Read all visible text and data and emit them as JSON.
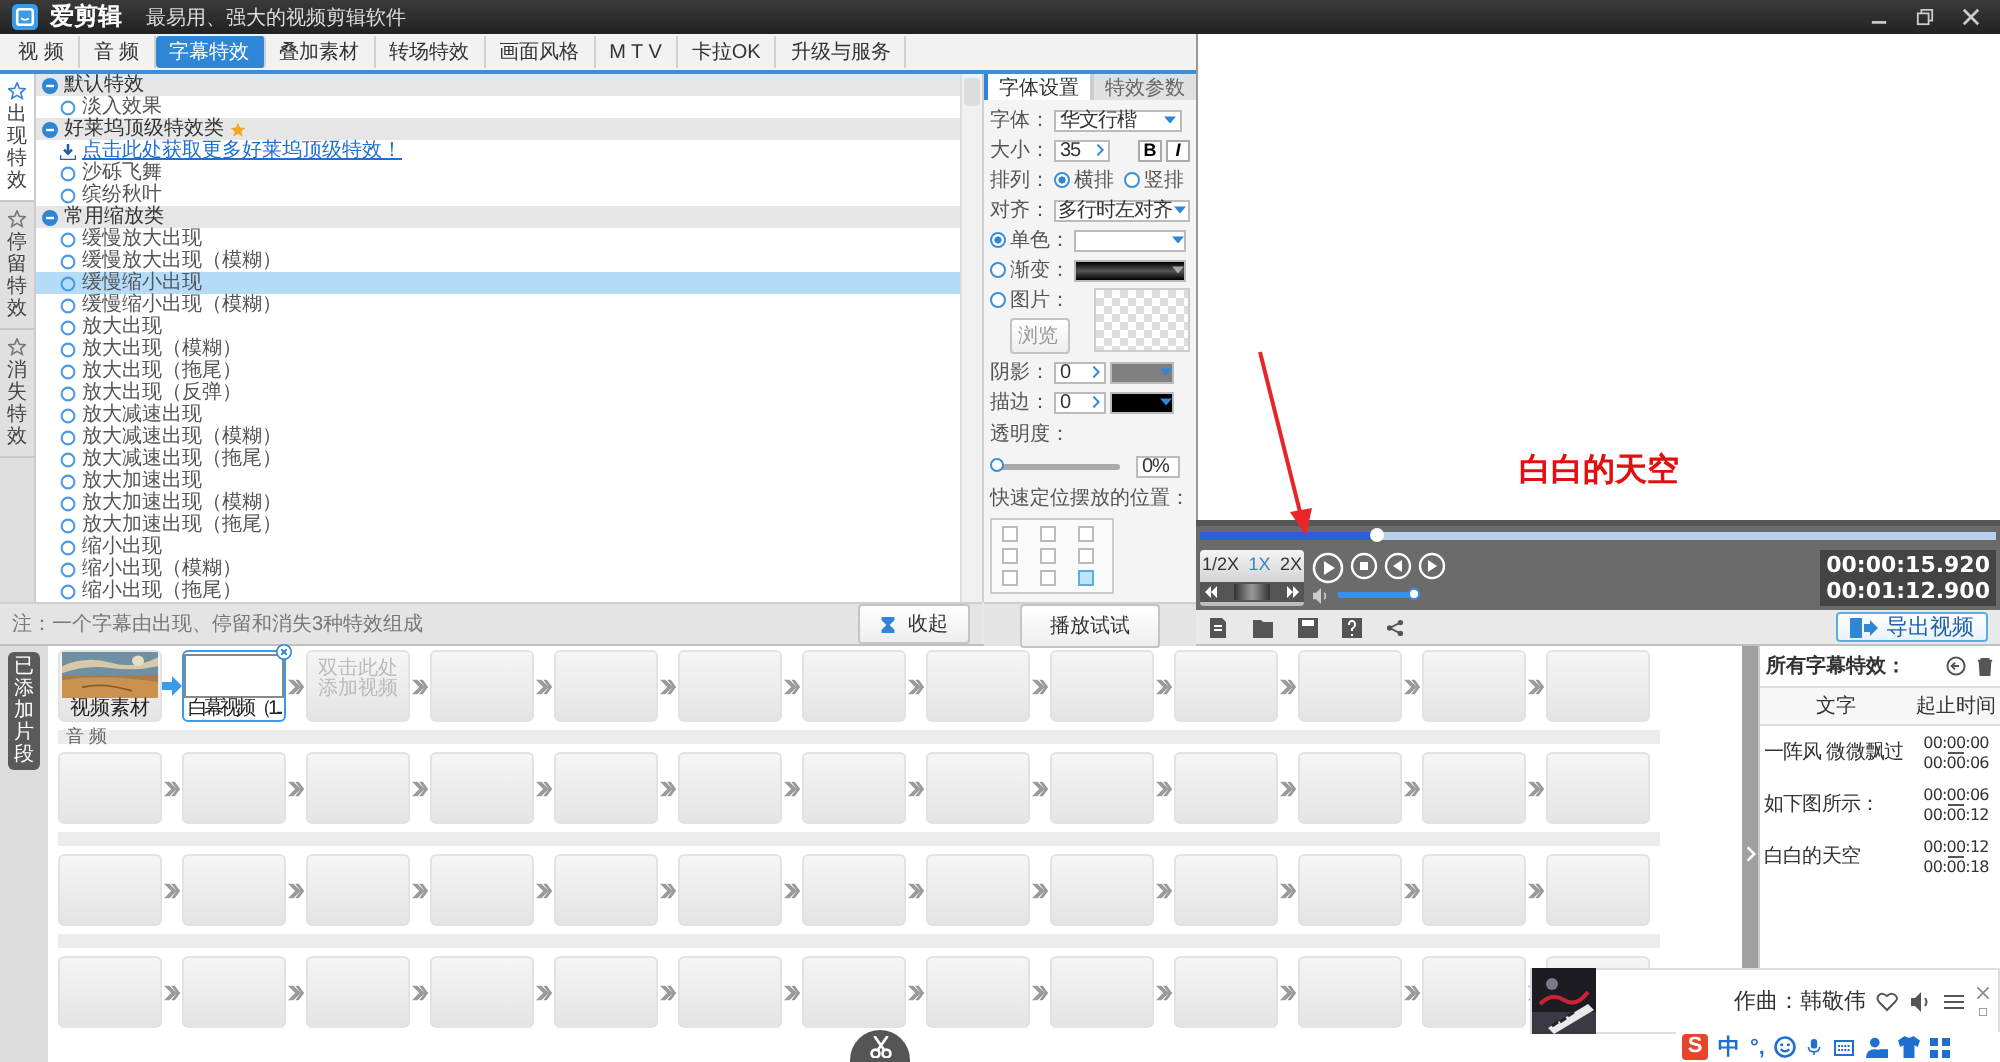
{
  "app": {
    "name": "爱剪辑",
    "tagline": "最易用、强大的视频剪辑软件"
  },
  "tabs": [
    {
      "label": "视 频",
      "selected": false
    },
    {
      "label": "音 频",
      "selected": false
    },
    {
      "label": "字幕特效",
      "selected": true
    },
    {
      "label": "叠加素材",
      "selected": false
    },
    {
      "label": "转场特效",
      "selected": false
    },
    {
      "label": "画面风格",
      "selected": false
    },
    {
      "label": "M T V",
      "selected": false
    },
    {
      "label": "卡拉OK",
      "selected": false
    },
    {
      "label": "升级与服务",
      "selected": false
    }
  ],
  "side_tabs": [
    {
      "label": "出现特效",
      "selected": true
    },
    {
      "label": "停留特效",
      "selected": false
    },
    {
      "label": "消失特效",
      "selected": false
    }
  ],
  "effect_groups": [
    {
      "title": "默认特效",
      "starred": false,
      "items": [
        {
          "kind": "option",
          "label": "淡入效果",
          "selected": false
        }
      ]
    },
    {
      "title": "好莱坞顶级特效类",
      "starred": true,
      "items": [
        {
          "kind": "link",
          "label": "点击此处获取更多好莱坞顶级特效！"
        },
        {
          "kind": "option",
          "label": "沙砾飞舞",
          "selected": false
        },
        {
          "kind": "option",
          "label": "缤纷秋叶",
          "selected": false
        }
      ]
    },
    {
      "title": "常用缩放类",
      "starred": false,
      "items": [
        {
          "kind": "option",
          "label": "缓慢放大出现",
          "selected": false
        },
        {
          "kind": "option",
          "label": "缓慢放大出现（模糊）",
          "selected": false
        },
        {
          "kind": "option",
          "label": "缓慢缩小出现",
          "selected": true
        },
        {
          "kind": "option",
          "label": "缓慢缩小出现（模糊）",
          "selected": false
        },
        {
          "kind": "option",
          "label": "放大出现",
          "selected": false
        },
        {
          "kind": "option",
          "label": "放大出现（模糊）",
          "selected": false
        },
        {
          "kind": "option",
          "label": "放大出现（拖尾）",
          "selected": false
        },
        {
          "kind": "option",
          "label": "放大出现（反弹）",
          "selected": false
        },
        {
          "kind": "option",
          "label": "放大减速出现",
          "selected": false
        },
        {
          "kind": "option",
          "label": "放大减速出现（模糊）",
          "selected": false
        },
        {
          "kind": "option",
          "label": "放大减速出现（拖尾）",
          "selected": false
        },
        {
          "kind": "option",
          "label": "放大加速出现",
          "selected": false
        },
        {
          "kind": "option",
          "label": "放大加速出现（模糊）",
          "selected": false
        },
        {
          "kind": "option",
          "label": "放大加速出现（拖尾）",
          "selected": false
        },
        {
          "kind": "option",
          "label": "缩小出现",
          "selected": false
        },
        {
          "kind": "option",
          "label": "缩小出现（模糊）",
          "selected": false
        },
        {
          "kind": "option",
          "label": "缩小出现（拖尾）",
          "selected": false
        }
      ]
    }
  ],
  "note": "注：一个字幕由出现、停留和消失3种特效组成",
  "collapse_button": "收起",
  "settings": {
    "tabs": [
      {
        "label": "字体设置",
        "selected": true
      },
      {
        "label": "特效参数",
        "selected": false
      }
    ],
    "font_label": "字体：",
    "font": "华文行楷",
    "size_label": "大小：",
    "size": "35",
    "bold_button": "B",
    "italic_button": "I",
    "layout_label": "排列：",
    "layout_options": [
      {
        "label": "横排",
        "selected": true
      },
      {
        "label": "竖排",
        "selected": false
      }
    ],
    "align_label": "对齐：",
    "align": "多行时左对齐",
    "fill_options": [
      {
        "kind": "color",
        "label": "单色：",
        "selected": true
      },
      {
        "kind": "gradient",
        "label": "渐变：",
        "selected": false
      },
      {
        "label": "图片：",
        "selected": false
      }
    ],
    "browse_button": "浏览",
    "shadow_label": "阴影：",
    "shadow": "0",
    "stroke_label": "描边：",
    "stroke": "0",
    "opacity_label": "透明度：",
    "opacity": {
      "level": 0
    },
    "opacity_value": "0%",
    "position_label": "快速定位摆放的位置：",
    "positions": [
      {
        "selected": false
      },
      {
        "selected": false
      },
      {
        "selected": false
      },
      {
        "selected": false
      },
      {
        "selected": false
      },
      {
        "selected": false
      },
      {
        "selected": false
      },
      {
        "selected": false
      },
      {
        "selected": true
      }
    ],
    "preview_button": "播放试试"
  },
  "preview": {
    "subtitle": "白白的天空",
    "progress": {
      "level": 0.22
    },
    "speeds": [
      {
        "label": "1/2X",
        "selected": false
      },
      {
        "label": "1X",
        "selected": true
      },
      {
        "label": "2X",
        "selected": false
      }
    ],
    "volume": {
      "level": 0.95
    },
    "current_time": "00:00:15.920",
    "total_time": "00:01:12.900",
    "export_button": "导出视频"
  },
  "timeline": {
    "tab": "已添加片段",
    "rows": [
      {
        "cells": [
          {
            "kind": "video",
            "label": "视频素材"
          },
          {
            "kind": "clip",
            "label": "白幕视频（1...",
            "selected": true
          },
          {
            "kind": "add",
            "label": "双击此处添加视频"
          },
          {
            "kind": "empty"
          },
          {
            "kind": "empty"
          },
          {
            "kind": "empty"
          },
          {
            "kind": "empty"
          },
          {
            "kind": "empty"
          },
          {
            "kind": "empty"
          },
          {
            "kind": "empty"
          },
          {
            "kind": "empty"
          },
          {
            "kind": "empty"
          },
          {
            "kind": "empty"
          }
        ]
      },
      {
        "heading": "音 频",
        "cells": [
          {
            "kind": "empty"
          },
          {
            "kind": "empty"
          },
          {
            "kind": "empty"
          },
          {
            "kind": "empty"
          },
          {
            "kind": "empty"
          },
          {
            "kind": "empty"
          },
          {
            "kind": "empty"
          },
          {
            "kind": "empty"
          },
          {
            "kind": "empty"
          },
          {
            "kind": "empty"
          },
          {
            "kind": "empty"
          },
          {
            "kind": "empty"
          },
          {
            "kind": "empty"
          }
        ]
      },
      {
        "cells": [
          {
            "kind": "empty"
          },
          {
            "kind": "empty"
          },
          {
            "kind": "empty"
          },
          {
            "kind": "empty"
          },
          {
            "kind": "empty"
          },
          {
            "kind": "empty"
          },
          {
            "kind": "empty"
          },
          {
            "kind": "empty"
          },
          {
            "kind": "empty"
          },
          {
            "kind": "empty"
          },
          {
            "kind": "empty"
          },
          {
            "kind": "empty"
          },
          {
            "kind": "empty"
          }
        ]
      },
      {
        "cells": [
          {
            "kind": "empty"
          },
          {
            "kind": "empty"
          },
          {
            "kind": "empty"
          },
          {
            "kind": "empty"
          },
          {
            "kind": "empty"
          },
          {
            "kind": "empty"
          },
          {
            "kind": "empty"
          },
          {
            "kind": "empty"
          },
          {
            "kind": "empty"
          },
          {
            "kind": "empty"
          },
          {
            "kind": "empty"
          },
          {
            "kind": "empty"
          },
          {
            "kind": "empty"
          }
        ]
      }
    ]
  },
  "subtitles": {
    "title": "所有字幕特效：",
    "columns": [
      "文字",
      "起止时间"
    ],
    "rows": [
      {
        "text": "一阵风 微微飘过",
        "start": "00:00:00",
        "end": "00:00:06"
      },
      {
        "text": "如下图所示：",
        "start": "00:00:06",
        "end": "00:00:12"
      },
      {
        "text": "白白的天空",
        "start": "00:00:12",
        "end": "00:00:18"
      }
    ]
  },
  "music": {
    "credit": "作曲：韩敬伟"
  },
  "ime": {
    "logo": "S",
    "mode": "中",
    "punctuation": "°,"
  }
}
